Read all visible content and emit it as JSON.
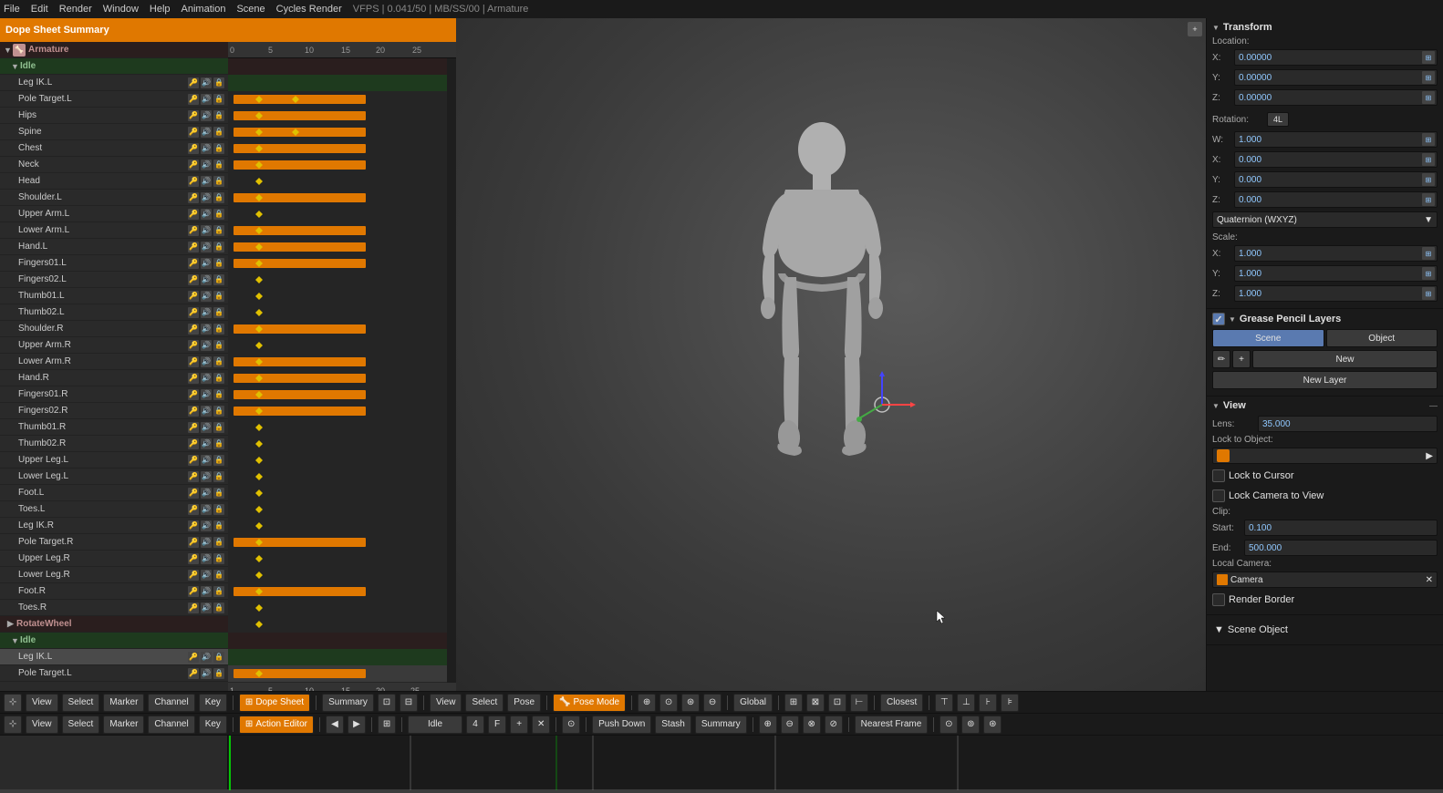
{
  "topMenu": {
    "items": [
      "File",
      "Edit",
      "Render",
      "Window",
      "Help",
      "Animation",
      "Scene",
      "Cycles Render",
      "VFPS",
      "0.041/50",
      "MB/SS/00",
      "Armature"
    ]
  },
  "dopeSheet": {
    "title": "Dope Sheet Summary",
    "channels": [
      {
        "name": "Armature",
        "type": "armature",
        "indent": 0
      },
      {
        "name": "Idle",
        "type": "group",
        "indent": 1
      },
      {
        "name": "Leg IK.L",
        "type": "bone",
        "indent": 2,
        "hasBar": true
      },
      {
        "name": "Pole Target.L",
        "type": "bone",
        "indent": 2,
        "hasBar": true
      },
      {
        "name": "Hips",
        "type": "bone",
        "indent": 2,
        "hasBar": true
      },
      {
        "name": "Spine",
        "type": "bone",
        "indent": 2,
        "hasBar": true
      },
      {
        "name": "Chest",
        "type": "bone",
        "indent": 2,
        "hasBar": true
      },
      {
        "name": "Neck",
        "type": "bone",
        "indent": 2,
        "hasBar": false
      },
      {
        "name": "Head",
        "type": "bone",
        "indent": 2,
        "hasBar": true
      },
      {
        "name": "Shoulder.L",
        "type": "bone",
        "indent": 2,
        "hasBar": false
      },
      {
        "name": "Upper Arm.L",
        "type": "bone",
        "indent": 2,
        "hasBar": true
      },
      {
        "name": "Lower Arm.L",
        "type": "bone",
        "indent": 2,
        "hasBar": true
      },
      {
        "name": "Hand.L",
        "type": "bone",
        "indent": 2,
        "hasBar": true
      },
      {
        "name": "Fingers01.L",
        "type": "bone",
        "indent": 2,
        "hasBar": false
      },
      {
        "name": "Fingers02.L",
        "type": "bone",
        "indent": 2,
        "hasBar": false
      },
      {
        "name": "Thumb01.L",
        "type": "bone",
        "indent": 2,
        "hasBar": false
      },
      {
        "name": "Thumb02.L",
        "type": "bone",
        "indent": 2,
        "hasBar": true
      },
      {
        "name": "Shoulder.R",
        "type": "bone",
        "indent": 2,
        "hasBar": false
      },
      {
        "name": "Upper Arm.R",
        "type": "bone",
        "indent": 2,
        "hasBar": true
      },
      {
        "name": "Lower Arm.R",
        "type": "bone",
        "indent": 2,
        "hasBar": true
      },
      {
        "name": "Hand.R",
        "type": "bone",
        "indent": 2,
        "hasBar": true
      },
      {
        "name": "Fingers01.R",
        "type": "bone",
        "indent": 2,
        "hasBar": true
      },
      {
        "name": "Fingers02.R",
        "type": "bone",
        "indent": 2,
        "hasBar": false
      },
      {
        "name": "Thumb01.R",
        "type": "bone",
        "indent": 2,
        "hasBar": false
      },
      {
        "name": "Thumb02.R",
        "type": "bone",
        "indent": 2,
        "hasBar": false
      },
      {
        "name": "Upper Leg.L",
        "type": "bone",
        "indent": 2,
        "hasBar": false
      },
      {
        "name": "Lower Leg.L",
        "type": "bone",
        "indent": 2,
        "hasBar": false
      },
      {
        "name": "Foot.L",
        "type": "bone",
        "indent": 2,
        "hasBar": false
      },
      {
        "name": "Toes.L",
        "type": "bone",
        "indent": 2,
        "hasBar": false
      },
      {
        "name": "Leg IK.R",
        "type": "bone",
        "indent": 2,
        "hasBar": true
      },
      {
        "name": "Pole Target.R",
        "type": "bone",
        "indent": 2,
        "hasBar": false
      },
      {
        "name": "Upper Leg.R",
        "type": "bone",
        "indent": 2,
        "hasBar": false
      },
      {
        "name": "Lower Leg.R",
        "type": "bone",
        "indent": 2,
        "hasBar": true
      },
      {
        "name": "Foot.R",
        "type": "bone",
        "indent": 2,
        "hasBar": false
      },
      {
        "name": "Toes.R",
        "type": "bone",
        "indent": 2,
        "hasBar": false
      },
      {
        "name": "RotateWheel",
        "type": "rotatewheel",
        "indent": 1
      },
      {
        "name": "Idle",
        "type": "group",
        "indent": 1
      },
      {
        "name": "Leg IK.L",
        "type": "bone",
        "indent": 2,
        "hasBar": true
      },
      {
        "name": "Pole Target.L",
        "type": "bone",
        "indent": 2,
        "hasBar": false
      }
    ],
    "rulerMarks": [
      "0",
      "5",
      "10",
      "15",
      "20",
      "25"
    ]
  },
  "transform": {
    "title": "Transform",
    "location": {
      "label": "Location:",
      "x": {
        "label": "X:",
        "value": "0.00000"
      },
      "y": {
        "label": "Y:",
        "value": "0.00000"
      },
      "z": {
        "label": "Z:",
        "value": "0.00000"
      }
    },
    "rotation": {
      "label": "Rotation:",
      "mode_label": "4L",
      "w": {
        "label": "W:",
        "value": "1.000"
      },
      "x": {
        "label": "X:",
        "value": "0.000"
      },
      "y": {
        "label": "Y:",
        "value": "0.000"
      },
      "z": {
        "label": "Z:",
        "value": "0.000"
      },
      "mode": "Quaternion (WXYZ)"
    },
    "scale": {
      "label": "Scale:",
      "x": {
        "label": "X:",
        "value": "1.000"
      },
      "y": {
        "label": "Y:",
        "value": "1.000"
      },
      "z": {
        "label": "Z:",
        "value": "1.000"
      }
    }
  },
  "greasePencil": {
    "title": "Grease Pencil Layers",
    "scene_btn": "Scene",
    "object_btn": "Object",
    "new_btn": "New",
    "new_layer_btn": "New Layer"
  },
  "view": {
    "title": "View",
    "lens_label": "Lens:",
    "lens_value": "35.000",
    "lock_object_label": "Lock to Object:",
    "lock_cursor_label": "Lock to Cursor",
    "lock_camera_label": "Lock Camera to View",
    "clip_label": "Clip:",
    "start_label": "Start:",
    "start_value": "0.100",
    "end_label": "End:",
    "end_value": "500.000",
    "local_camera_label": "Local Camera:",
    "camera_value": "Camera",
    "render_border_label": "Render Border"
  },
  "bottomToolbar1": {
    "view_btn": "View",
    "select_btn": "Select",
    "marker_btn": "Marker",
    "channel_btn": "Channel",
    "key_btn": "Key",
    "dope_sheet_btn": "Dope Sheet",
    "summary_btn": "Summary",
    "view2_btn": "View",
    "select2_btn": "Select",
    "pose_btn": "Pose",
    "pose_mode_btn": "Pose Mode",
    "global_btn": "Global",
    "closest_btn": "Closest"
  },
  "bottomToolbar2": {
    "view_btn": "View",
    "select_btn": "Select",
    "marker_btn": "Marker",
    "channel_btn": "Channel",
    "key_btn": "Key",
    "action_editor_btn": "Action Editor",
    "idle_btn": "Idle",
    "frame_num": "4",
    "f_btn": "F",
    "push_down_btn": "Push Down",
    "stash_btn": "Stash",
    "summary_btn": "Summary",
    "nearest_frame_btn": "Nearest Frame"
  },
  "sceneObject": {
    "label": "Scene Object"
  },
  "lockToCursor": {
    "label": "Lock to Cursor"
  }
}
